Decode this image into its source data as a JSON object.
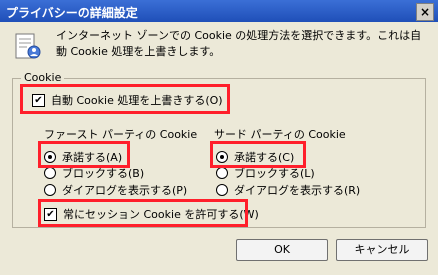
{
  "window": {
    "title": "プライバシーの詳細設定",
    "close_symbol": "×"
  },
  "description": "インターネット ゾーンでの Cookie の処理方法を選択できます。これは自動 Cookie 処理を上書きします。",
  "group": {
    "legend": "Cookie",
    "override_checkbox": {
      "label": "自動 Cookie 処理を上書きする(O)",
      "checked": true
    }
  },
  "first_party": {
    "title": "ファースト パーティの Cookie",
    "options": [
      {
        "label": "承諾する(A)",
        "selected": true
      },
      {
        "label": "ブロックする(B)",
        "selected": false
      },
      {
        "label": "ダイアログを表示する(P)",
        "selected": false
      }
    ]
  },
  "third_party": {
    "title": "サード パーティの Cookie",
    "options": [
      {
        "label": "承諾する(C)",
        "selected": true
      },
      {
        "label": "ブロックする(L)",
        "selected": false
      },
      {
        "label": "ダイアログを表示する(R)",
        "selected": false
      }
    ]
  },
  "session_checkbox": {
    "label": "常にセッション Cookie を許可する(W)",
    "checked": true
  },
  "buttons": {
    "ok": "OK",
    "cancel": "キャンセル"
  },
  "colors": {
    "highlight": "#ff1f2b",
    "titlebar": "#1f4fb8"
  }
}
